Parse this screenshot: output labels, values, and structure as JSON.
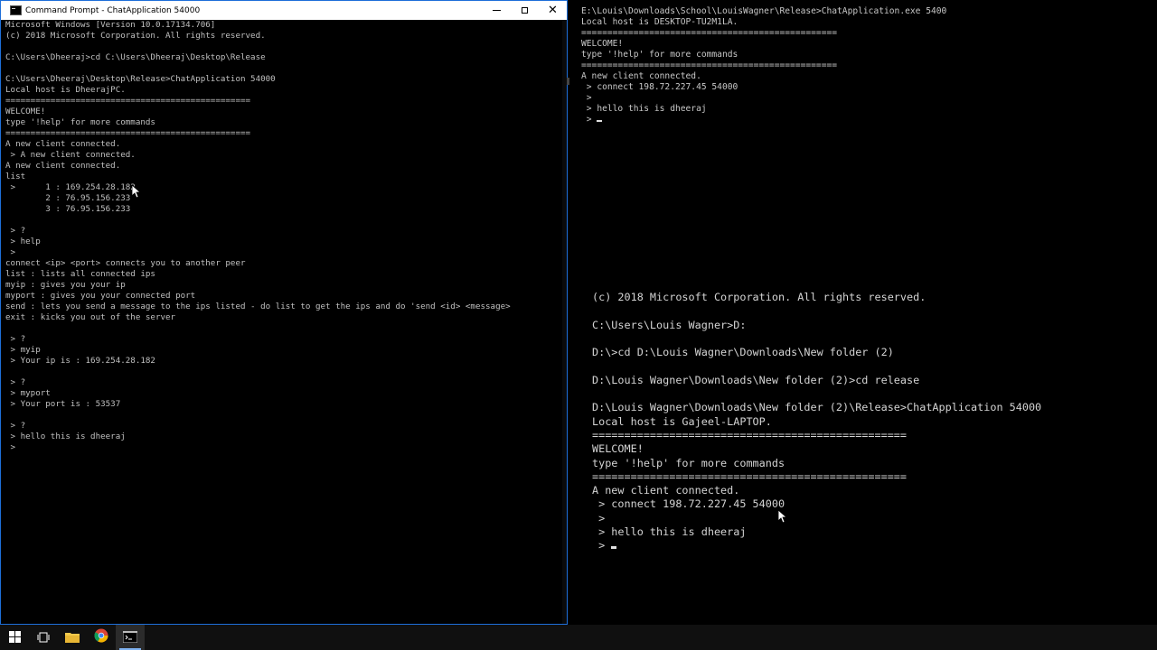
{
  "window": {
    "title": "Command Prompt - ChatApplication  54000",
    "buttons": {
      "minimize": "minimize",
      "maximize": "maximize",
      "close": "✕"
    }
  },
  "left_console": [
    "Microsoft Windows [Version 10.0.17134.706]",
    "(c) 2018 Microsoft Corporation. All rights reserved.",
    "",
    "C:\\Users\\Dheeraj>cd C:\\Users\\Dheeraj\\Desktop\\Release",
    "",
    "C:\\Users\\Dheeraj\\Desktop\\Release>ChatApplication 54000",
    "Local host is DheerajPC.",
    "=================================================",
    "WELCOME!",
    "type '!help' for more commands",
    "=================================================",
    "A new client connected.",
    " > A new client connected.",
    "A new client connected.",
    "list",
    " >      1 : 169.254.28.182",
    "        2 : 76.95.156.233",
    "        3 : 76.95.156.233",
    "",
    " > ?",
    " > help",
    " >",
    "connect <ip> <port> connects you to another peer",
    "list : lists all connected ips",
    "myip : gives you your ip",
    "myport : gives you your connected port",
    "send : lets you send a message to the ips listed - do list to get the ips and do 'send <id> <message>",
    "exit : kicks you out of the server",
    "",
    " > ?",
    " > myip",
    " > Your ip is : 169.254.28.182",
    "",
    " > ?",
    " > myport",
    " > Your port is : 53537",
    "",
    " > ?",
    " > hello this is dheeraj",
    " >"
  ],
  "right_top_console": [
    "E:\\Louis\\Downloads\\School\\LouisWagner\\Release>ChatApplication.exe 5400",
    "Local host is DESKTOP-TU2M1LA.",
    "=================================================",
    "WELCOME!",
    "type '!help' for more commands",
    "=================================================",
    "A new client connected.",
    " > connect 198.72.227.45 54000",
    " >",
    " > hello this is dheeraj",
    " > "
  ],
  "right_bottom_console": [
    "(c) 2018 Microsoft Corporation. All rights reserved.",
    "",
    "C:\\Users\\Louis Wagner>D:",
    "",
    "D:\\>cd D:\\Louis Wagner\\Downloads\\New folder (2)",
    "",
    "D:\\Louis Wagner\\Downloads\\New folder (2)>cd release",
    "",
    "D:\\Louis Wagner\\Downloads\\New folder (2)\\Release>ChatApplication 54000",
    "Local host is Gajeel-LAPTOP.",
    "=================================================",
    "WELCOME!",
    "type '!help' for more commands",
    "=================================================",
    "A new client connected.",
    " > connect 198.72.227.45 54000",
    " >",
    " > hello this is dheeraj",
    " > "
  ],
  "taskbar": {
    "items": [
      {
        "name": "start-button",
        "icon": "windows-logo-icon"
      },
      {
        "name": "task-view-button",
        "icon": "task-view-icon"
      },
      {
        "name": "file-explorer-button",
        "icon": "folder-icon"
      },
      {
        "name": "chrome-button",
        "icon": "chrome-icon"
      },
      {
        "name": "command-prompt-button",
        "icon": "console-icon"
      }
    ]
  },
  "colors": {
    "console_text": "#c0c0c0",
    "window_border": "#1e6fd9",
    "taskbar": "#101010",
    "folder_yellow": "#f2c94c",
    "chrome_red": "#db4437",
    "chrome_yellow": "#f4b400",
    "chrome_green": "#0f9d58",
    "chrome_blue": "#4285f4"
  }
}
